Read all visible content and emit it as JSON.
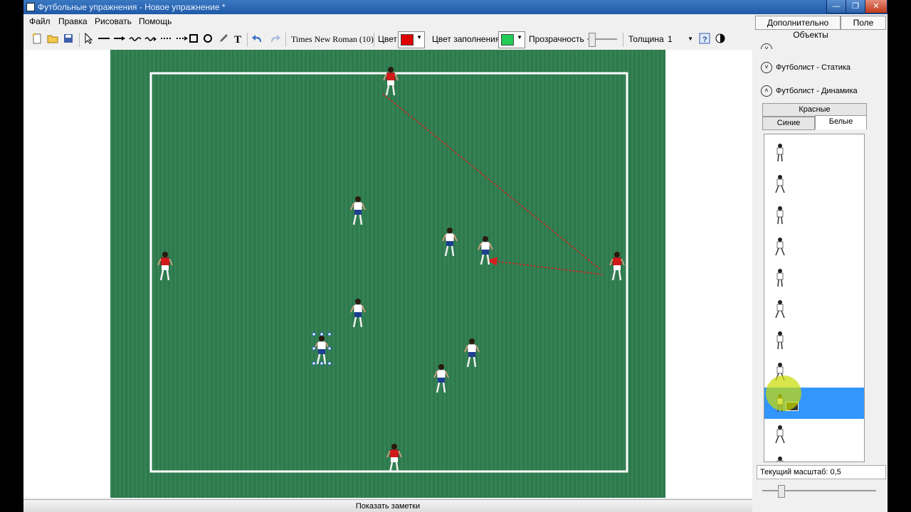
{
  "window": {
    "title": "Футбольные упражнения - Новое упражнение *",
    "min": "—",
    "max": "❐",
    "close": "✕"
  },
  "menu": [
    "Файл",
    "Правка",
    "Рисовать",
    "Помощь"
  ],
  "toolbar": {
    "font": "Times New Roman (10)",
    "color_label": "Цвет",
    "color": "#e00000",
    "fill_label": "Цвет заполнения",
    "fill_color": "#22cc55",
    "opacity_label": "Прозрачность",
    "opacity_value": 0.0,
    "thickness_label": "Толщина",
    "thickness_value": "1",
    "help_icon": "?"
  },
  "notes_button": "Показать заметки",
  "right_panel": {
    "tabs": [
      "Дополнительно",
      "Поле"
    ],
    "caption": "Объекты",
    "categories": [
      {
        "label": "Футболист - Статика",
        "icon": "chevron-down"
      },
      {
        "label": "Футболист - Динамика",
        "icon": "chevron-up"
      }
    ],
    "team_tabs": [
      "Красные",
      "Синие",
      "Белые"
    ],
    "active_team": "Белые",
    "selected_item_index": 8,
    "zoom_label": "Текущий масштаб: 0,5",
    "zoom_value": 0.5
  },
  "pitch": {
    "grass": "#2e7d4f",
    "line": "#ffffff",
    "arrow_color": "#d62020",
    "players": [
      {
        "team": "red"
      },
      {
        "team": "red"
      },
      {
        "team": "red"
      },
      {
        "team": "red"
      },
      {
        "team": "white"
      },
      {
        "team": "white"
      },
      {
        "team": "white"
      },
      {
        "team": "white"
      },
      {
        "team": "white",
        "selected": true
      },
      {
        "team": "white"
      },
      {
        "team": "white"
      }
    ]
  }
}
